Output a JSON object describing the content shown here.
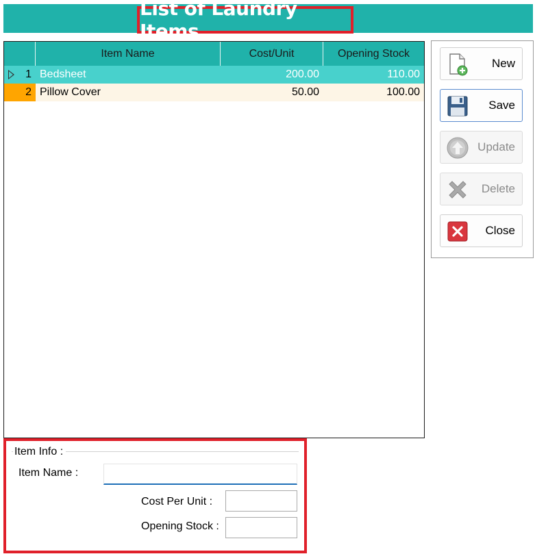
{
  "window": {
    "title": "List of Laundry Items"
  },
  "grid": {
    "columns": [
      "Item Name",
      "Cost/Unit",
      "Opening Stock"
    ],
    "rows": [
      {
        "no": "1",
        "item_name": "Bedsheet",
        "cost_unit": "200.00",
        "opening_stock": "110.00",
        "selected": true
      },
      {
        "no": "2",
        "item_name": "Pillow Cover",
        "cost_unit": "50.00",
        "opening_stock": "100.00",
        "selected": false
      }
    ]
  },
  "buttons": {
    "new": {
      "label": "New",
      "icon": "new-document-icon",
      "enabled": true
    },
    "save": {
      "label": "Save",
      "icon": "floppy-disk-icon",
      "enabled": true
    },
    "update": {
      "label": "Update",
      "icon": "up-arrow-icon",
      "enabled": false
    },
    "delete": {
      "label": "Delete",
      "icon": "x-cross-icon",
      "enabled": false
    },
    "close": {
      "label": "Close",
      "icon": "close-icon",
      "enabled": true
    }
  },
  "item_info": {
    "group_label": "Item Info :",
    "item_name_label": "Item Name :",
    "item_name_value": "",
    "cost_label": "Cost Per Unit :",
    "cost_value": "",
    "stock_label": "Opening Stock :",
    "stock_value": ""
  },
  "colors": {
    "header_teal": "#20b2aa",
    "selected_row": "#48d1cc",
    "alt_row": "#fdf5e6",
    "row_header_orange": "#ffa500",
    "highlight_red": "#e0202a"
  }
}
